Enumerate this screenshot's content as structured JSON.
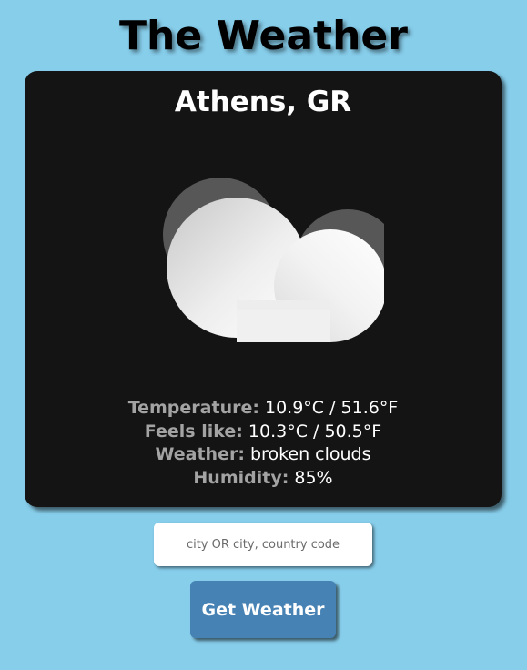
{
  "app": {
    "title": "The Weather"
  },
  "weather": {
    "location": "Athens, GR",
    "icon": "broken-clouds-icon",
    "details": [
      {
        "label": "Temperature:",
        "value": "10.9°C / 51.6°F"
      },
      {
        "label": "Feels like:",
        "value": "10.3°C / 50.5°F"
      },
      {
        "label": "Weather:",
        "value": "broken clouds"
      },
      {
        "label": "Humidity:",
        "value": "85%"
      }
    ]
  },
  "search": {
    "value": "",
    "placeholder": "city OR city, country code"
  },
  "actions": {
    "get_weather_label": "Get Weather"
  },
  "colors": {
    "background": "#87ceeb",
    "card": "#141414",
    "label": "#a3a3a3",
    "button": "#4682b4"
  }
}
